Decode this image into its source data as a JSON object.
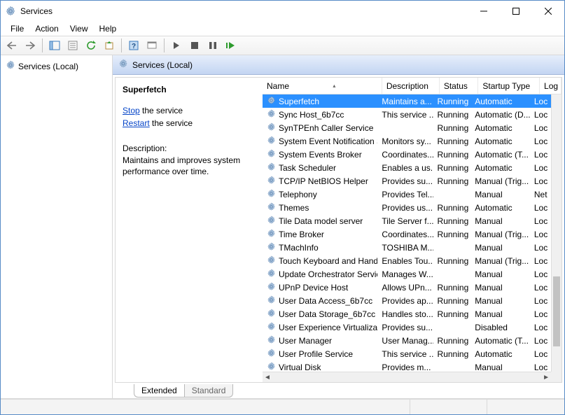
{
  "window": {
    "title": "Services"
  },
  "menu": {
    "file": "File",
    "action": "Action",
    "view": "View",
    "help": "Help"
  },
  "tree": {
    "root": "Services (Local)"
  },
  "pane_header": "Services (Local)",
  "detail": {
    "selected_name": "Superfetch",
    "stop_label": "Stop",
    "stop_suffix": " the service",
    "restart_label": "Restart",
    "restart_suffix": " the service",
    "desc_label": "Description:",
    "desc_text": "Maintains and improves system performance over time."
  },
  "columns": {
    "name": "Name",
    "description": "Description",
    "status": "Status",
    "startup": "Startup Type",
    "logon": "Log"
  },
  "sort_indicator": "▴",
  "tabs": {
    "extended": "Extended",
    "standard": "Standard"
  },
  "services": [
    {
      "name": "Superfetch",
      "desc": "Maintains a...",
      "status": "Running",
      "startup": "Automatic",
      "logon": "Loc",
      "selected": true
    },
    {
      "name": "Sync Host_6b7cc",
      "desc": "This service ...",
      "status": "Running",
      "startup": "Automatic (D...",
      "logon": "Loc"
    },
    {
      "name": "SynTPEnh Caller Service",
      "desc": "",
      "status": "Running",
      "startup": "Automatic",
      "logon": "Loc"
    },
    {
      "name": "System Event Notification S...",
      "desc": "Monitors sy...",
      "status": "Running",
      "startup": "Automatic",
      "logon": "Loc"
    },
    {
      "name": "System Events Broker",
      "desc": "Coordinates...",
      "status": "Running",
      "startup": "Automatic (T...",
      "logon": "Loc"
    },
    {
      "name": "Task Scheduler",
      "desc": "Enables a us...",
      "status": "Running",
      "startup": "Automatic",
      "logon": "Loc"
    },
    {
      "name": "TCP/IP NetBIOS Helper",
      "desc": "Provides su...",
      "status": "Running",
      "startup": "Manual (Trig...",
      "logon": "Loc"
    },
    {
      "name": "Telephony",
      "desc": "Provides Tel...",
      "status": "",
      "startup": "Manual",
      "logon": "Net"
    },
    {
      "name": "Themes",
      "desc": "Provides us...",
      "status": "Running",
      "startup": "Automatic",
      "logon": "Loc"
    },
    {
      "name": "Tile Data model server",
      "desc": "Tile Server f...",
      "status": "Running",
      "startup": "Manual",
      "logon": "Loc"
    },
    {
      "name": "Time Broker",
      "desc": "Coordinates...",
      "status": "Running",
      "startup": "Manual (Trig...",
      "logon": "Loc"
    },
    {
      "name": "TMachInfo",
      "desc": "TOSHIBA M...",
      "status": "",
      "startup": "Manual",
      "logon": "Loc"
    },
    {
      "name": "Touch Keyboard and Hand...",
      "desc": "Enables Tou...",
      "status": "Running",
      "startup": "Manual (Trig...",
      "logon": "Loc"
    },
    {
      "name": "Update Orchestrator Service",
      "desc": "Manages W...",
      "status": "",
      "startup": "Manual",
      "logon": "Loc"
    },
    {
      "name": "UPnP Device Host",
      "desc": "Allows UPn...",
      "status": "Running",
      "startup": "Manual",
      "logon": "Loc"
    },
    {
      "name": "User Data Access_6b7cc",
      "desc": "Provides ap...",
      "status": "Running",
      "startup": "Manual",
      "logon": "Loc"
    },
    {
      "name": "User Data Storage_6b7cc",
      "desc": "Handles sto...",
      "status": "Running",
      "startup": "Manual",
      "logon": "Loc"
    },
    {
      "name": "User Experience Virtualizatio...",
      "desc": "Provides su...",
      "status": "",
      "startup": "Disabled",
      "logon": "Loc"
    },
    {
      "name": "User Manager",
      "desc": "User Manag...",
      "status": "Running",
      "startup": "Automatic (T...",
      "logon": "Loc"
    },
    {
      "name": "User Profile Service",
      "desc": "This service ...",
      "status": "Running",
      "startup": "Automatic",
      "logon": "Loc"
    },
    {
      "name": "Virtual Disk",
      "desc": "Provides m...",
      "status": "",
      "startup": "Manual",
      "logon": "Loc"
    }
  ]
}
